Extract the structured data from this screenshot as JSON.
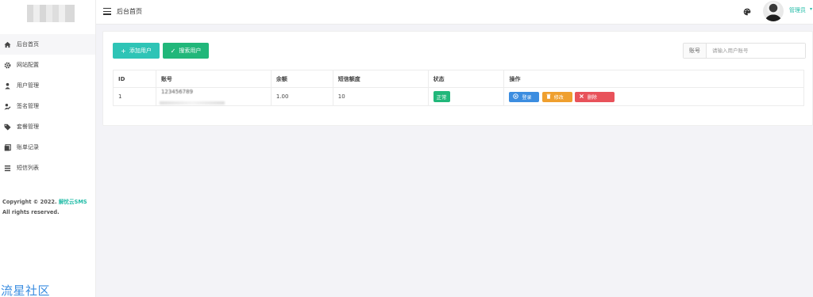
{
  "sidebar": {
    "items": [
      {
        "label": "后台首页",
        "icon": "home-icon",
        "active": true
      },
      {
        "label": "网站配置",
        "icon": "gear-icon",
        "active": false
      },
      {
        "label": "用户管理",
        "icon": "user-icon",
        "active": false
      },
      {
        "label": "签名管理",
        "icon": "user-edit-icon",
        "active": false
      },
      {
        "label": "套餐管理",
        "icon": "tag-icon",
        "active": false
      },
      {
        "label": "账单记录",
        "icon": "bill-icon",
        "active": false
      },
      {
        "label": "短信列表",
        "icon": "list-icon",
        "active": false
      }
    ],
    "copyright_prefix": "Copyright © 2022.",
    "copyright_brand": "解忧云SMS",
    "copyright_suffix": "All rights reserved.",
    "watermark": "流星社区"
  },
  "topbar": {
    "title": "后台首页",
    "admin_name": "管理员",
    "caret": "▾"
  },
  "toolbar": {
    "add_label": "添加用户",
    "add_icon": "+",
    "search_label": "搜索用户",
    "search_icon": "✓"
  },
  "search": {
    "label": "账号",
    "placeholder": "请输入用户账号"
  },
  "table": {
    "headers": [
      "ID",
      "账号",
      "余额",
      "短信额度",
      "状态",
      "操作"
    ],
    "rows": [
      {
        "id": "1",
        "account": "123456789",
        "balance": "1.00",
        "quota": "10",
        "status": "正常"
      }
    ],
    "actions": {
      "login": "登录",
      "edit": "修改",
      "delete": "删除"
    }
  },
  "colors": {
    "accent": "#2ec4b6",
    "success": "#21b77a",
    "primary": "#3c8de0",
    "warning": "#ef9f2e",
    "danger": "#e8525a"
  }
}
